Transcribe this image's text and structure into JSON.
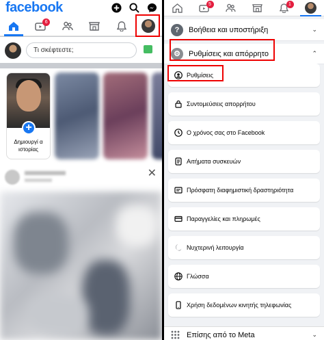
{
  "left": {
    "logo": "facebook",
    "tabs": [
      {
        "icon": "home-icon",
        "active": true
      },
      {
        "icon": "video-icon",
        "badge": "6"
      },
      {
        "icon": "friends-icon"
      },
      {
        "icon": "marketplace-icon"
      },
      {
        "icon": "bell-icon"
      },
      {
        "icon": "profile-menu-icon"
      }
    ],
    "composer_placeholder": "Τι σκέφτεστε;",
    "story_create_label": "Δημιουργί α ιστορίας"
  },
  "right": {
    "tabs": [
      {
        "icon": "home-icon"
      },
      {
        "icon": "video-icon",
        "badge": "5"
      },
      {
        "icon": "friends-icon"
      },
      {
        "icon": "marketplace-icon"
      },
      {
        "icon": "bell-icon",
        "badge": "1"
      },
      {
        "icon": "profile-menu-icon",
        "active": true
      }
    ],
    "help_section": "Βοήθεια και υποστήριξη",
    "settings_section": "Ρυθμίσεις και απόρρητο",
    "items": [
      {
        "label": "Ρυθμίσεις",
        "icon": "profile-settings-icon"
      },
      {
        "label": "Συντομεύσεις απορρήτου",
        "icon": "lock-icon"
      },
      {
        "label": "Ο χρόνος σας στο Facebook",
        "icon": "clock-icon"
      },
      {
        "label": "Αιτήματα συσκευών",
        "icon": "device-icon"
      },
      {
        "label": "Πρόσφατη διαφημιστική δραστηριότητα",
        "icon": "ad-activity-icon"
      },
      {
        "label": "Παραγγελίες και πληρωμές",
        "icon": "card-icon"
      },
      {
        "label": "Νυχτερινή λειτουργία",
        "icon": "moon-icon"
      },
      {
        "label": "Γλώσσα",
        "icon": "globe-icon"
      },
      {
        "label": "Χρήση δεδομένων κινητής τηλεφωνίας",
        "icon": "phone-icon"
      }
    ],
    "meta_section": "Επίσης από το Meta"
  },
  "colors": {
    "brand": "#1877f2",
    "highlight": "#e00000",
    "badge": "#e41e3f"
  }
}
